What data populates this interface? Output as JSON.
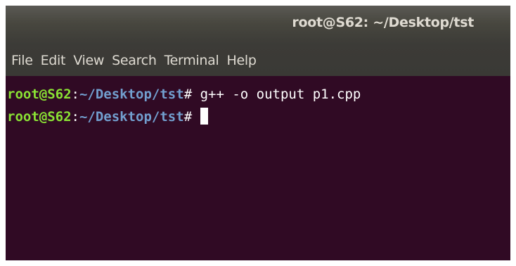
{
  "window": {
    "title": "root@S62: ~/Desktop/tst"
  },
  "menubar": {
    "items": [
      {
        "label": "File"
      },
      {
        "label": "Edit"
      },
      {
        "label": "View"
      },
      {
        "label": "Search"
      },
      {
        "label": "Terminal"
      },
      {
        "label": "Help"
      }
    ]
  },
  "terminal": {
    "lines": [
      {
        "user": "root@S62",
        "sep": ":",
        "path": "~/Desktop/tst",
        "prompt_char": "# ",
        "command": "g++ -o output p1.cpp"
      },
      {
        "user": "root@S62",
        "sep": ":",
        "path": "~/Desktop/tst",
        "prompt_char": "# ",
        "command": ""
      }
    ]
  },
  "colors": {
    "background": "#300a24",
    "user": "#8ae234",
    "path": "#729fcf",
    "text": "#ffffff",
    "titlebar": "#3c3b37"
  }
}
